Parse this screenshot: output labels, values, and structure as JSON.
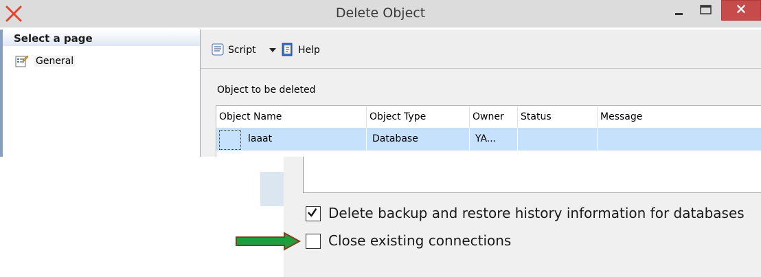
{
  "window": {
    "title": "Delete Object",
    "app_icon": "red-x-icon",
    "controls": [
      "minimize-icon",
      "maximize-icon",
      "close-icon"
    ]
  },
  "left_panel": {
    "header": "Select a page",
    "pages": [
      {
        "label": "General",
        "icon": "properties-page-icon"
      }
    ]
  },
  "toolbar": {
    "script_label": "Script",
    "help_label": "Help",
    "script_icon": "script-scroll-icon",
    "help_icon": "help-book-icon",
    "dropdown_icon": "chevron-down-icon"
  },
  "objects_section": {
    "label": "Object to be deleted",
    "columns": [
      "Object Name",
      "Object Type",
      "Owner",
      "Status",
      "Message"
    ],
    "rows": [
      {
        "name": "laaat",
        "type": "Database",
        "owner": "YA...",
        "status": "",
        "message": ""
      }
    ]
  },
  "options": [
    {
      "label": "Delete backup and restore history information for databases",
      "checked": true
    },
    {
      "label": "Close existing connections",
      "checked": false
    }
  ],
  "annotation": {
    "arrow_icon": "green-arrow-icon",
    "arrow_color": "#1e9e3e",
    "arrow_outline": "#8a3a1a"
  },
  "colors": {
    "titlebar": "#dcdcdc",
    "close_button": "#c84b4b",
    "selection": "#c6e1fb",
    "panel_background": "#f0f0f0"
  }
}
